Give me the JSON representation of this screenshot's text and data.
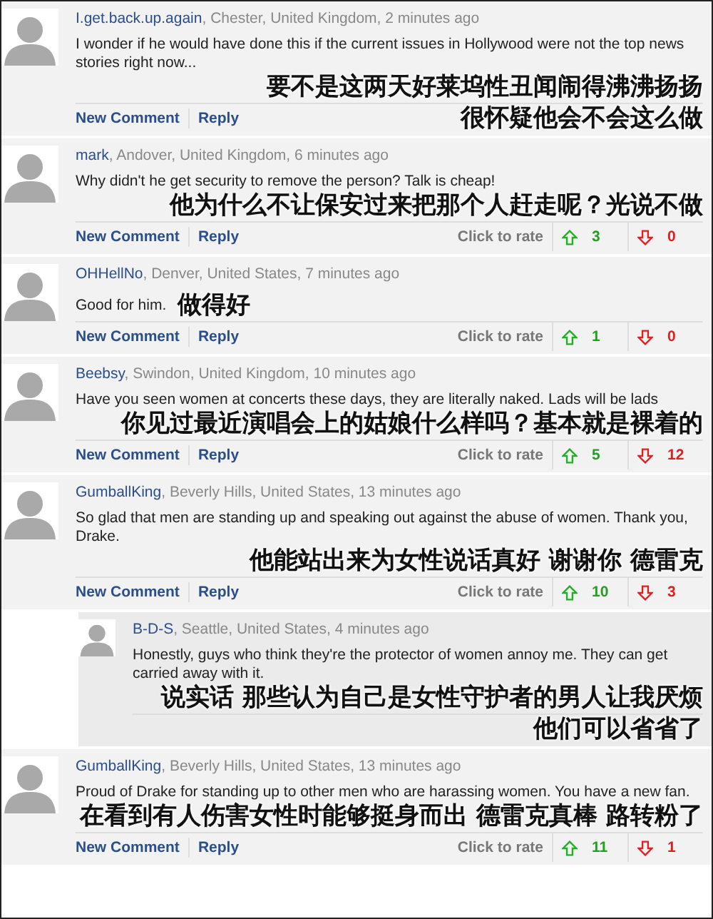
{
  "comments": [
    {
      "author": "I.get.back.up.again",
      "meta": ", Chester, United Kingdom, 2 minutes ago",
      "body": "I wonder if he would have done this if the current issues in Hollywood were not the top news stories right now...",
      "reply": false,
      "caption": [
        {
          "kind": "below",
          "text": "要不是这两天好莱坞性丑闻闹得沸沸扬扬"
        },
        {
          "kind": "footer",
          "text": "很怀疑他会不会这么做"
        }
      ],
      "actions": [
        "New Comment",
        "Reply"
      ]
    },
    {
      "author": "mark",
      "meta": ", Andover, United Kingdom, 6 minutes ago",
      "body": "Why didn't he get security to remove the person? Talk is cheap!",
      "reply": false,
      "caption": [
        {
          "kind": "below",
          "text": "他为什么不让保安过来把那个人赶走呢？光说不做"
        }
      ],
      "actions": [
        "New Comment",
        "Reply"
      ],
      "rating": {
        "label": "Click to rate",
        "up": "3",
        "down": "0"
      }
    },
    {
      "author": "OHHellNo",
      "meta": ", Denver, United States, 7 minutes ago",
      "body": "Good for him.",
      "reply": false,
      "caption": [
        {
          "kind": "inline",
          "text": "做得好"
        }
      ],
      "actions": [
        "New Comment",
        "Reply"
      ],
      "rating": {
        "label": "Click to rate",
        "up": "1",
        "down": "0"
      }
    },
    {
      "author": "Beebsy",
      "meta": ", Swindon, United Kingdom, 10 minutes ago",
      "body": "Have you seen women at concerts these days, they are literally naked. Lads will be lads",
      "reply": false,
      "caption": [
        {
          "kind": "below",
          "text": "你见过最近演唱会上的姑娘什么样吗？基本就是裸着的"
        }
      ],
      "actions": [
        "New Comment",
        "Reply"
      ],
      "rating": {
        "label": "Click to rate",
        "up": "5",
        "down": "12"
      }
    },
    {
      "author": "GumballKing",
      "meta": ", Beverly Hills, United States, 13 minutes ago",
      "body": "So glad that men are standing up and speaking out against the abuse of women. Thank you, Drake.",
      "reply": false,
      "caption": [
        {
          "kind": "below",
          "text": "他能站出来为女性说话真好 谢谢你 德雷克"
        }
      ],
      "actions": [
        "New Comment",
        "Reply"
      ],
      "rating": {
        "label": "Click to rate",
        "up": "10",
        "down": "3"
      }
    },
    {
      "author": "B-D-S",
      "meta": ", Seattle, United States, 4 minutes ago",
      "body": "Honestly, guys who think they're the protector of women annoy me. They can get carried away with it.",
      "reply": true,
      "caption": [
        {
          "kind": "below",
          "text": "说实话 那些认为自己是女性守护者的男人让我厌烦"
        },
        {
          "kind": "footer",
          "text": "他们可以省省了"
        }
      ]
    },
    {
      "author": "GumballKing",
      "meta": ", Beverly Hills, United States, 13 minutes ago",
      "body": "Proud of Drake for standing up to other men who are harassing women. You have a new fan.",
      "reply": false,
      "caption": [
        {
          "kind": "below",
          "text": "在看到有人伤害女性时能够挺身而出 德雷克真棒 路转粉了"
        }
      ],
      "actions": [
        "New Comment",
        "Reply"
      ],
      "rating": {
        "label": "Click to rate",
        "up": "11",
        "down": "1"
      }
    }
  ]
}
